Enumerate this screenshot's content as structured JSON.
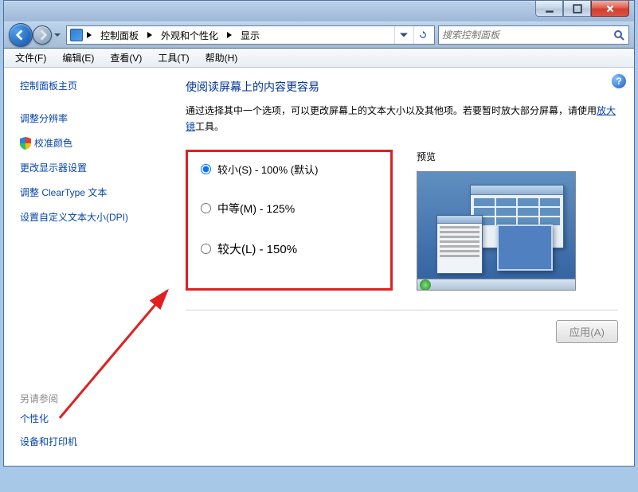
{
  "breadcrumb": {
    "root_tooltip": "",
    "items": [
      "控制面板",
      "外观和个性化",
      "显示"
    ]
  },
  "search": {
    "placeholder": "搜索控制面板"
  },
  "menus": {
    "file": "文件(F)",
    "edit": "编辑(E)",
    "view": "查看(V)",
    "tools": "工具(T)",
    "help": "帮助(H)"
  },
  "sidebar": {
    "home": "控制面板主页",
    "links": [
      "调整分辨率",
      "校准颜色",
      "更改显示器设置",
      "调整 ClearType 文本",
      "设置自定义文本大小(DPI)"
    ],
    "see_also_head": "另请参阅",
    "see_also": [
      "个性化",
      "设备和打印机"
    ]
  },
  "main": {
    "title": "使阅读屏幕上的内容更容易",
    "desc_a": "通过选择其中一个选项，可以更改屏幕上的文本大小以及其他项。若要暂时放大部分屏幕，请使用",
    "desc_link": "放大镜",
    "desc_b": "工具。",
    "option_small": "较小(S) - 100% (默认)",
    "option_medium": "中等(M) - 125%",
    "option_large": "较大(L) - 150%",
    "preview_label": "预览",
    "apply": "应用(A)",
    "help_tooltip": "?"
  }
}
